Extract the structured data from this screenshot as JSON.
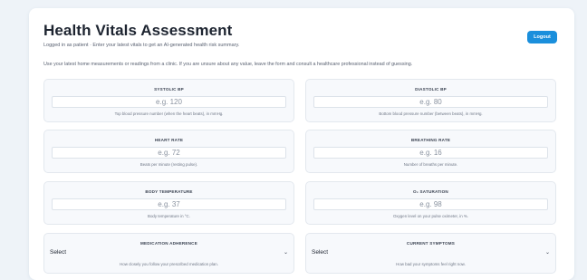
{
  "header": {
    "title": "Health Vitals Assessment",
    "subtitle": "Logged in as patient · Enter your latest vitals to get an AI-generated health risk summary.",
    "logout_label": "Logout"
  },
  "intro": "Use your latest home measurements or readings from a clinic. If you are unsure about any value, leave the form and consult a healthcare professional instead of guessing.",
  "fields": {
    "systolic": {
      "label": "SYSTOLIC BP",
      "placeholder": "e.g. 120",
      "help": "Top blood pressure number (when the heart beats), in mmHg."
    },
    "diastolic": {
      "label": "DIASTOLIC BP",
      "placeholder": "e.g. 80",
      "help": "Bottom blood pressure number (between beats), in mmHg."
    },
    "heart_rate": {
      "label": "HEART RATE",
      "placeholder": "e.g. 72",
      "help": "Beats per minute (resting pulse)."
    },
    "breathing_rate": {
      "label": "BREATHING RATE",
      "placeholder": "e.g. 16",
      "help": "Number of breaths per minute."
    },
    "temperature": {
      "label": "BODY TEMPERATURE",
      "placeholder": "e.g. 37",
      "help": "Body temperature in °C."
    },
    "o2": {
      "label": "O₂ SATURATION",
      "placeholder": "e.g. 98",
      "help": "Oxygen level on your pulse oximeter, in %."
    },
    "medication": {
      "label": "MEDICATION ADHERENCE",
      "value": "Select",
      "help": "How closely you follow your prescribed medication plan."
    },
    "symptoms": {
      "label": "CURRENT SYMPTOMS",
      "value": "Select",
      "help": "How bad your symptoms feel right now."
    }
  },
  "icons": {
    "select_chevron": "chevron-down-icon"
  },
  "colors": {
    "accent": "#1a8fdc",
    "background": "#eef3f8",
    "card": "#ffffff"
  }
}
